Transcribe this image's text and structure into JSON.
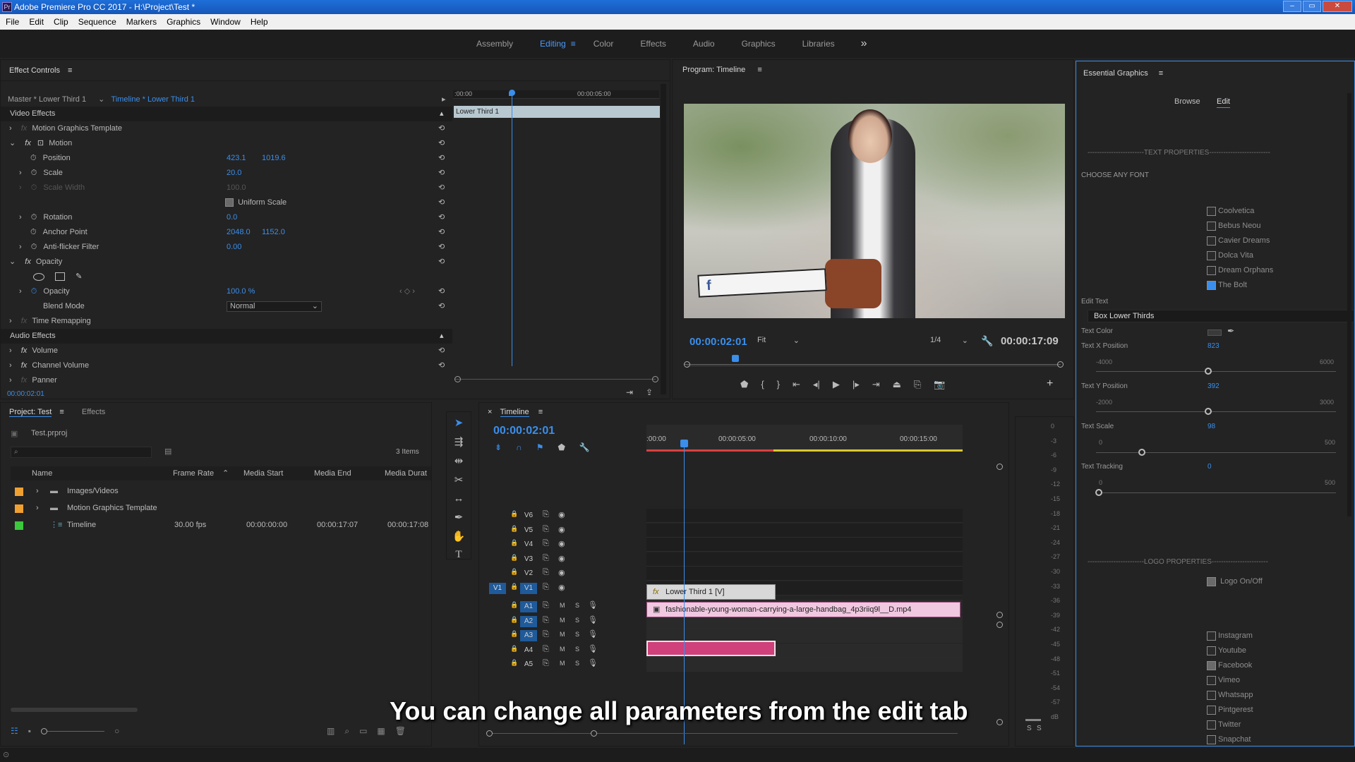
{
  "window": {
    "title": "Adobe Premiere Pro CC 2017 - H:\\Project\\Test *",
    "app_icon": "Pr"
  },
  "menu": [
    "File",
    "Edit",
    "Clip",
    "Sequence",
    "Markers",
    "Graphics",
    "Window",
    "Help"
  ],
  "workspaces": {
    "items": [
      "Assembly",
      "Editing",
      "Color",
      "Effects",
      "Audio",
      "Graphics",
      "Libraries"
    ],
    "active": "Editing",
    "more": "»"
  },
  "effect_controls": {
    "title": "Effect Controls",
    "source": "Master * Lower Third 1",
    "sequence": "Timeline * Lower Third 1",
    "video_effects": "Video Effects",
    "mgt": "Motion Graphics Template",
    "motion": "Motion",
    "position_label": "Position",
    "position_x": "423.1",
    "position_y": "1019.6",
    "scale_label": "Scale",
    "scale": "20.0",
    "scale_width_label": "Scale Width",
    "scale_width": "100.0",
    "uniform_label": "Uniform Scale",
    "rotation_label": "Rotation",
    "rotation": "0.0",
    "anchor_label": "Anchor Point",
    "anchor_x": "2048.0",
    "anchor_y": "1152.0",
    "flicker_label": "Anti-flicker Filter",
    "flicker": "0.00",
    "opacity_group": "Opacity",
    "opacity_label": "Opacity",
    "opacity": "100.0 %",
    "blend_label": "Blend Mode",
    "blend": "Normal",
    "time_remap": "Time Remapping",
    "audio_effects": "Audio Effects",
    "volume": "Volume",
    "channel_volume": "Channel Volume",
    "panner": "Panner",
    "timecode": "00:00:02:01",
    "mini_ruler_start": ":00:00",
    "mini_ruler_mid": "00:00:05:00",
    "mini_clip": "Lower Third 1"
  },
  "program": {
    "title": "Program: Timeline",
    "timecode": "00:00:02:01",
    "fit": "Fit",
    "quality": "1/4",
    "duration": "00:00:17:09"
  },
  "essential_graphics": {
    "title": "Essential Graphics",
    "tabs": [
      "Browse",
      "Edit"
    ],
    "active_tab": "Edit",
    "text_props_header": "------------------------TEXT PROPERTIES--------------------------",
    "choose_font": "CHOOSE ANY FONT",
    "fonts": [
      {
        "name": "Coolvetica",
        "checked": false
      },
      {
        "name": "Bebus Neou",
        "checked": false
      },
      {
        "name": "Cavier Dreams",
        "checked": false
      },
      {
        "name": "Dolca Vita",
        "checked": false
      },
      {
        "name": "Dream Orphans",
        "checked": false
      },
      {
        "name": "The Bolt",
        "checked": true
      }
    ],
    "edit_text_label": "Edit Text",
    "edit_text": "Box Lower Thirds",
    "text_color_label": "Text Color",
    "xpos_label": "Text X Position",
    "xpos": "823",
    "xpos_min": "-4000",
    "xpos_max": "6000",
    "ypos_label": "Text Y Position",
    "ypos": "392",
    "ypos_min": "-2000",
    "ypos_max": "3000",
    "scale_label": "Text Scale",
    "scale": "98",
    "scale_min": "0",
    "scale_max": "500",
    "tracking_label": "Text Tracking",
    "tracking": "0",
    "tracking_min": "0",
    "tracking_max": "500",
    "logo_props_header": "------------------------LOGO PROPERTIES------------------------",
    "logo_onoff": "Logo On/Off",
    "logos": [
      {
        "name": "Instagram",
        "checked": false
      },
      {
        "name": "Youtube",
        "checked": false
      },
      {
        "name": "Facebook",
        "checked": true
      },
      {
        "name": "Vimeo",
        "checked": false
      },
      {
        "name": "Whatsapp",
        "checked": false
      },
      {
        "name": "Pintgerest",
        "checked": false
      },
      {
        "name": "Twitter",
        "checked": false
      },
      {
        "name": "Snapchat",
        "checked": false
      }
    ]
  },
  "project": {
    "tab": "Project: Test",
    "effects_tab": "Effects",
    "file": "Test.prproj",
    "count": "3 Items",
    "columns": [
      "Name",
      "Frame Rate",
      "Media Start",
      "Media End",
      "Media Durat"
    ],
    "rows": [
      {
        "name": "Images/Videos",
        "rate": "",
        "start": "",
        "end": "",
        "dur": "",
        "color": "#f0a030"
      },
      {
        "name": "Motion Graphics Template",
        "rate": "",
        "start": "",
        "end": "",
        "dur": "",
        "color": "#f0a030"
      },
      {
        "name": "Timeline",
        "rate": "30.00 fps",
        "start": "00:00:00:00",
        "end": "00:00:17:07",
        "dur": "00:00:17:08",
        "color": "#3cc83c"
      }
    ]
  },
  "timeline": {
    "tab": "Timeline",
    "timecode": "00:00:02:01",
    "ruler": [
      ":00:00",
      "00:00:05:00",
      "00:00:10:00",
      "00:00:15:00"
    ],
    "video_tracks": [
      "V6",
      "V5",
      "V4",
      "V3",
      "V2",
      "V1"
    ],
    "audio_tracks": [
      "A1",
      "A2",
      "A3",
      "A4",
      "A5"
    ],
    "source_v": "V1",
    "clip_lower": "Lower Third 1 [V]",
    "clip_video": "fashionable-young-woman-carrying-a-large-handbag_4p3riiq9l__D.mp4",
    "m": "M",
    "s": "S"
  },
  "meter": {
    "labels": [
      "0",
      "-3",
      "-6",
      "-9",
      "-12",
      "-15",
      "-18",
      "-21",
      "-24",
      "-27",
      "-30",
      "-33",
      "-36",
      "-39",
      "-42",
      "-45",
      "-48",
      "-51",
      "-54",
      "-57",
      "dB"
    ],
    "solo": [
      "S",
      "S"
    ]
  },
  "caption": "You can change all parameters from the edit tab",
  "colors": {
    "accent": "#3b8eea",
    "titlebar": "#1e6fd9",
    "clip_pink": "#f0c8e0",
    "clip_audio": "#d0407a",
    "clip_lower": "#d8d8d8"
  }
}
